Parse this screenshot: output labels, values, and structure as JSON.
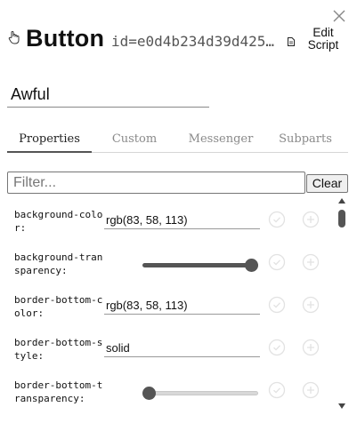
{
  "header": {
    "title": "Button",
    "object_id": "id=e0d4b234d39d425…",
    "edit_script_line1": "Edit",
    "edit_script_line2": "Script"
  },
  "name_field": {
    "value": "Awful"
  },
  "tabs": [
    {
      "label": "Properties",
      "active": true
    },
    {
      "label": "Custom",
      "active": false
    },
    {
      "label": "Messenger",
      "active": false
    },
    {
      "label": "Subparts",
      "active": false
    }
  ],
  "filter": {
    "placeholder": "Filter...",
    "value": "",
    "clear_label": "Clear"
  },
  "properties": [
    {
      "name": "background-color:",
      "kind": "text",
      "value": "rgb(83, 58, 113)"
    },
    {
      "name": "background-transparency:",
      "kind": "slider",
      "level": 1.0
    },
    {
      "name": "border-bottom-color:",
      "kind": "text",
      "value": "rgb(83, 58, 113)"
    },
    {
      "name": "border-bottom-style:",
      "kind": "text",
      "value": "solid"
    },
    {
      "name": "border-bottom-transparency:",
      "kind": "slider",
      "level": 0.0
    }
  ],
  "colors": {
    "slider_filled": "#555555",
    "slider_empty": "#d8d8d8",
    "row_icon": "#e2e2e2",
    "accent_text": "#111111"
  },
  "icons": {
    "close": "close-icon",
    "hand": "hand-pointer-icon",
    "doc": "document-icon",
    "row_action_1": "check-circle-icon",
    "row_action_2": "add-circle-icon"
  }
}
